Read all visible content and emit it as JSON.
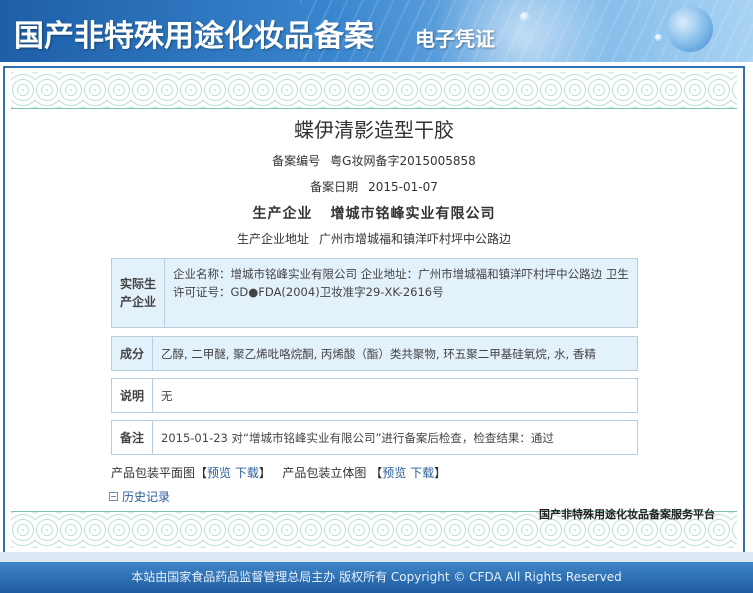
{
  "header": {
    "title": "国产非特殊用途化妆品备案",
    "subtitle": "电子凭证"
  },
  "product": {
    "name": "蝶伊清影造型干胶",
    "record_no_label": "备案编号",
    "record_no": "粤G妆网备字2015005858",
    "record_date_label": "备案日期",
    "record_date": "2015-01-07",
    "producer_label": "生产企业",
    "producer": "增城市铭峰实业有限公司",
    "producer_address_label": "生产企业地址",
    "producer_address": "广州市增城福和镇洋吓村坪中公路边"
  },
  "boxes": {
    "actual_producer": {
      "label": "实际生产企业",
      "text": "企业名称：增城市铭峰实业有限公司    企业地址：广州市增城福和镇洋吓村坪中公路边    卫生许可证号：GD●FDA(2004)卫妆准字29-XK-2616号"
    },
    "ingredients": {
      "label": "成分",
      "text": "乙醇, 二甲醚, 聚乙烯吡咯烷酮, 丙烯酸（酯）类共聚物, 环五聚二甲基硅氧烷, 水, 香精"
    },
    "notes": {
      "label": "说明",
      "text": "无"
    },
    "remarks": {
      "label": "备注",
      "text": "2015-01-23 对“增城市铭峰实业有限公司”进行备案后检查，检查结果：通过"
    }
  },
  "downloads": {
    "flat_label": "产品包装平面图",
    "solid_label": "产品包装立体图",
    "preview": "预览",
    "download": "下载",
    "open_bracket": "【",
    "close_bracket": "】"
  },
  "history_label": "历史记录",
  "platform_label": "国产非特殊用途化妆品备案服务平台",
  "footer": "本站由国家食品药品监督管理总局主办 版权所有 Copyright © CFDA All Rights Reserved",
  "colors": {
    "banner": "#2a6fb8",
    "frame_border": "#2f6fb2",
    "box_blue": "#e3f1fb",
    "link": "#2a5d9a",
    "footer": "#2a6fb0"
  }
}
